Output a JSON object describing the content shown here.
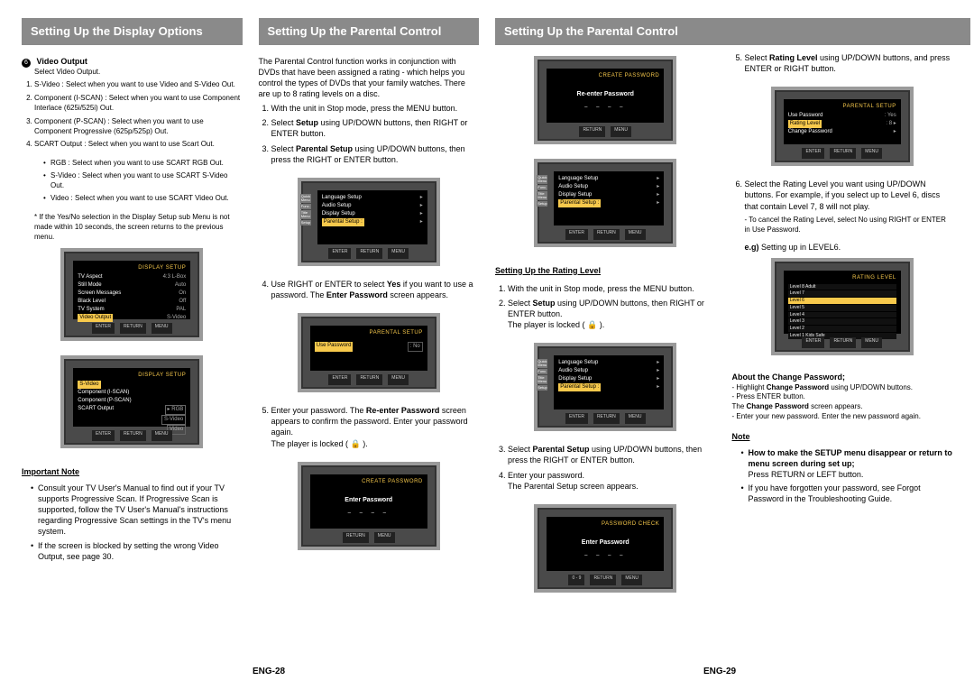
{
  "col1": {
    "banner": "Setting Up the Display Options",
    "video_output_num": "6",
    "video_output_title": "Video Output",
    "video_output_sub": "Select Video Output.",
    "items": [
      "S-Video : Select when you want to use Video and S-Video Out.",
      "Component (I-SCAN) : Select when you want to use Component Interlace (625i/525i) Out.",
      "Component (P-SCAN) : Select when you want to use Component Progressive (625p/525p) Out.",
      "SCART Output : Select when you want to use Scart Out."
    ],
    "scart_sub": [
      "RGB : Select when you want to use SCART RGB Out.",
      "S-Video : Select when you want to use SCART S-Video Out.",
      "Video : Select when you want to use SCART Video Out."
    ],
    "star": "If the Yes/No selection in the Display Setup sub Menu is not made within 10 seconds, the screen returns to the previous menu.",
    "tv1_title": "DISPLAY SETUP",
    "tv1_rows": [
      [
        "TV Aspect",
        ":",
        "4:3 L-Box"
      ],
      [
        "Still Mode",
        ":",
        "Auto"
      ],
      [
        "Screen Messages",
        ":",
        "On"
      ],
      [
        "Black Level",
        ":",
        "Off"
      ],
      [
        "TV System",
        ":",
        "PAL"
      ],
      [
        "Video Output",
        ":",
        "S-Video"
      ]
    ],
    "tv2_title": "DISPLAY SETUP",
    "tv2_hl": "S-Video",
    "tv2_rows": [
      "Component (I-SCAN)",
      "Component (P-SCAN)",
      "SCART Output"
    ],
    "tv2_opts": [
      "RGB",
      "S-Video",
      "Video"
    ],
    "important_note": "Important Note",
    "note1": "Consult your TV User's Manual to find out if your TV supports Progressive Scan. If Progressive Scan is supported, follow the TV User's Manual's instructions regarding Progressive Scan settings in the TV's menu system.",
    "note2": "If the screen is blocked by setting the wrong Video Output, see page 30."
  },
  "col2": {
    "banner": "Setting Up the Parental Control",
    "intro": "The Parental Control function works in conjunction with DVDs that have been assigned a rating - which helps you control the types of DVDs that your family watches. There are up to 8 rating levels on a disc.",
    "s1": "With the unit in Stop mode, press the MENU button.",
    "s2a": "Select ",
    "s2b": "Setup",
    "s2c": " using UP/DOWN buttons, then RIGHT or ENTER button.",
    "s3a": "Select ",
    "s3b": "Parental Setup",
    "s3c": " using UP/DOWN buttons, then press the RIGHT or ENTER button.",
    "tvA_rows": [
      "Language Setup",
      "Audio Setup",
      "Display Setup"
    ],
    "tvA_hl": "Parental Setup :",
    "s4a": "Use RIGHT or ENTER to select ",
    "s4b": "Yes",
    "s4c": " if you want to use a password. The ",
    "s4d": "Enter Password",
    "s4e": " screen appears.",
    "tvB_title": "PARENTAL SETUP",
    "tvB_row": "Use Password",
    "tvB_roff": "No",
    "s5a": "Enter your password. The ",
    "s5b": "Re-enter Password",
    "s5c": " screen appears to confirm the password. Enter your password again.",
    "s5d": "The player is locked ( 🔒 ).",
    "tvC_title": "CREATE PASSWORD",
    "tvC_text": "Enter Password",
    "btn_enter": "ENTER",
    "btn_return": "RETURN",
    "btn_menu": "MENU"
  },
  "col3": {
    "banner": "Setting Up the Parental Control",
    "tvD_title": "CREATE PASSWORD",
    "tvD_text": "Re-enter Password",
    "tvE_rows": [
      "Language Setup",
      "Audio Setup",
      "Display Setup"
    ],
    "tvE_hl": "Parental Setup :",
    "sub": "Setting Up the Rating Level",
    "s1": "With the unit in Stop mode, press the MENU button.",
    "s2a": "Select ",
    "s2b": "Setup",
    "s2c": " using UP/DOWN buttons, then RIGHT or ENTER button.",
    "s2d": "The player is locked ( 🔒 ).",
    "tvF_rows": [
      "Language Setup",
      "Audio Setup",
      "Display Setup"
    ],
    "tvF_hl": "Parental Setup :",
    "s3a": "Select ",
    "s3b": "Parental Setup",
    "s3c": " using UP/DOWN buttons, then press the RIGHT or ENTER button.",
    "s4": "Enter your password.",
    "s4b": "The Parental Setup screen appears.",
    "tvG_title": "PASSWORD CHECK",
    "tvG_text": "Enter Password",
    "tvG_counter": "0 - 9"
  },
  "col4": {
    "s5a": "Select ",
    "s5b": "Rating Level",
    "s5c": " using UP/DOWN buttons, and press ENTER or RIGHT button.",
    "tvH_title": "PARENTAL SETUP",
    "tvH_rows": [
      [
        "Use Password",
        ":",
        "Yes"
      ],
      [
        "Rating Level",
        ":",
        "8"
      ],
      [
        "Change Password",
        "",
        ""
      ]
    ],
    "s6a": "Select the Rating Level you want using UP/DOWN buttons. For example, if you select up to Level 6, discs that contain Level 7, 8 will not play.",
    "s6b": "- To cancel the Rating Level, select No using RIGHT or ENTER in Use Password.",
    "eg_label": "e.g)",
    "eg_text": " Setting up in LEVEL6.",
    "tvI_title": "RATING LEVEL",
    "tvI_levels": [
      "Level 8 Adult",
      "Level 7",
      "Level 6",
      "Level 5",
      "Level 4",
      "Level 3",
      "Level 2",
      "Level 1 Kids Safe"
    ],
    "tvI_sel": 2,
    "about": "About the Change Password;",
    "a1a": "- Highlight ",
    "a1b": "Change Password",
    "a1c": " using UP/DOWN buttons.",
    "a2": "- Press ENTER button.",
    "a3a": "  The ",
    "a3b": "Change Password",
    "a3c": " screen appears.",
    "a4": "- Enter your new password. Enter the new password again.",
    "note_title": "Note",
    "n1": "How to make the SETUP menu disappear or return to menu screen during set up;",
    "n1b": "Press RETURN or LEFT button.",
    "n2": "If you have forgotten your password, see Forgot Password in the Troubleshooting Guide."
  },
  "pn_left": "ENG-28",
  "pn_right": "ENG-29"
}
